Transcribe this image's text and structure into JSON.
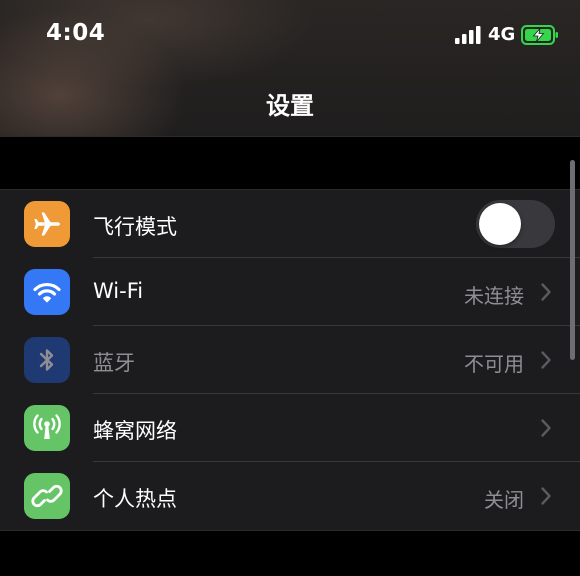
{
  "status_bar": {
    "time": "4:04",
    "network_type": "4G",
    "signal_icon": "cellular-signal-icon",
    "battery_icon": "battery-charging-icon",
    "battery_color": "#32d74b"
  },
  "nav": {
    "title": "设置"
  },
  "settings": {
    "rows": [
      {
        "label": "飞行模式",
        "icon": "airplane-icon",
        "icon_color": "#f09a37",
        "control": "toggle",
        "toggle_on": false
      },
      {
        "label": "Wi-Fi",
        "icon": "wifi-icon",
        "icon_color": "#3478f6",
        "value": "未连接"
      },
      {
        "label": "蓝牙",
        "icon": "bluetooth-icon",
        "icon_color": "#1f3a73",
        "value": "不可用",
        "disabled": true
      },
      {
        "label": "蜂窝网络",
        "icon": "cellular-antenna-icon",
        "icon_color": "#65c466",
        "value": ""
      },
      {
        "label": "个人热点",
        "icon": "hotspot-link-icon",
        "icon_color": "#65c466",
        "value": "关闭"
      }
    ]
  },
  "colors": {
    "background": "#000000",
    "group_background": "#1c1c1e",
    "secondary_text": "#8e8e93",
    "separator": "#38383a"
  }
}
